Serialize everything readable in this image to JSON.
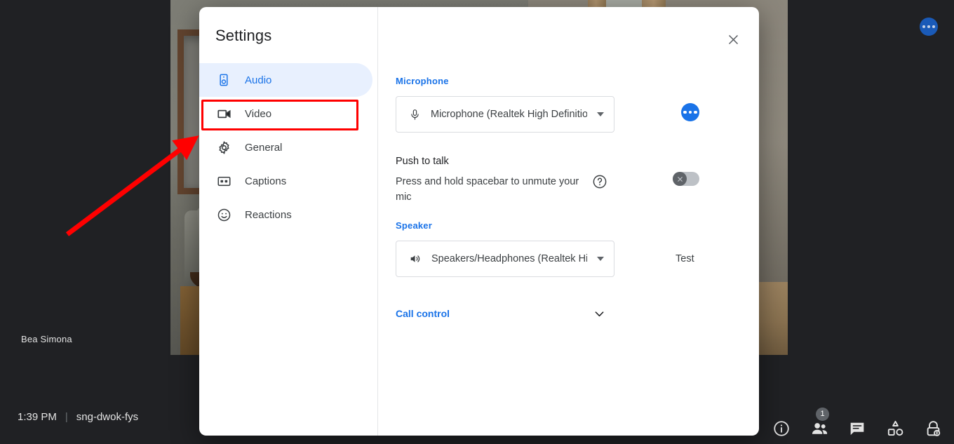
{
  "meeting": {
    "self_name": "Bea Simona",
    "time": "1:39 PM",
    "divider": "|",
    "code": "sng-dwok-fys",
    "top_more_icon": "more-options-icon"
  },
  "bottom_bar": {
    "items": [
      {
        "name": "meeting-details-button",
        "icon": "info-icon",
        "badge": ""
      },
      {
        "name": "participants-button",
        "icon": "people-icon",
        "badge": "1"
      },
      {
        "name": "chat-button",
        "icon": "chat-bubble-icon",
        "badge": ""
      },
      {
        "name": "activities-button",
        "icon": "activities-shapes-icon",
        "badge": ""
      },
      {
        "name": "host-controls-button",
        "icon": "lock-shield-icon",
        "badge": ""
      }
    ]
  },
  "dialog": {
    "title": "Settings",
    "close_icon": "close-icon",
    "nav": [
      {
        "label": "Audio",
        "icon": "speaker-icon",
        "active": true
      },
      {
        "label": "Video",
        "icon": "videocam-icon",
        "active": false
      },
      {
        "label": "General",
        "icon": "gear-icon",
        "active": false
      },
      {
        "label": "Captions",
        "icon": "closed-captions-icon",
        "active": false
      },
      {
        "label": "Reactions",
        "icon": "smiley-face-icon",
        "active": false
      }
    ],
    "highlight": {
      "target": "Video",
      "color": "#ff0000"
    },
    "microphone": {
      "label": "Microphone",
      "selected": "Microphone (Realtek High Definitio...",
      "icon": "microphone-icon",
      "more_icon": "more-options-icon"
    },
    "push_to_talk": {
      "title": "Push to talk",
      "description": "Press and hold spacebar to unmute your mic",
      "help_icon": "help-circle-icon",
      "toggle_state": "off",
      "toggle_knob_icon": "x-icon"
    },
    "speaker": {
      "label": "Speaker",
      "selected": "Speakers/Headphones (Realtek Hig...",
      "icon": "volume-icon",
      "test_label": "Test"
    },
    "call_control": {
      "label": "Call control",
      "chevron_icon": "chevron-down-icon",
      "expanded": false
    }
  },
  "colors": {
    "accent_blue": "#1a73e8",
    "active_pill": "#e8f0fe",
    "annotation_red": "#ff0000",
    "app_background": "#202124"
  }
}
